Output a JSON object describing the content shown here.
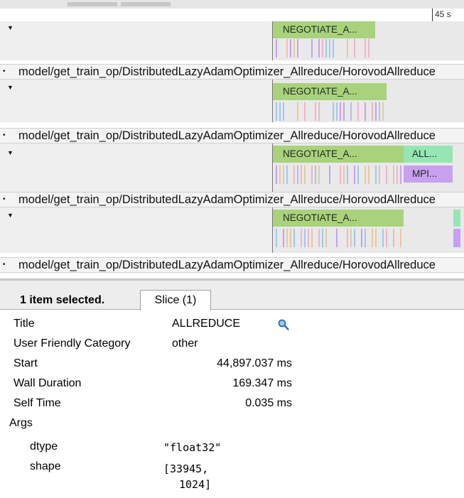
{
  "timeline": {
    "ruler_label": "45 s",
    "path_text": "model/get_train_op/DistributedLazyAdamOptimizer_Allreduce/HorovodAllreduce",
    "tracks": [
      {
        "slices": [
          {
            "label": "NEGOTIATE_A...",
            "color": "#a9d27c"
          }
        ]
      },
      {
        "slices": [
          {
            "label": "NEGOTIATE_A...",
            "color": "#a9d27c"
          }
        ]
      },
      {
        "slices": [
          {
            "label": "NEGOTIATE_A...",
            "color": "#a9d27c"
          },
          {
            "label": "ALL...",
            "color": "#96e6b4"
          },
          {
            "label": "MPI...",
            "color": "#c8a0f0"
          }
        ]
      },
      {
        "slices": [
          {
            "label": "NEGOTIATE_A...",
            "color": "#a9d27c"
          }
        ]
      }
    ]
  },
  "panel": {
    "selection_text": "1 item selected.",
    "tab_label": "Slice (1)",
    "fields": {
      "title_key": "Title",
      "title_val": "ALLREDUCE",
      "category_key": "User Friendly Category",
      "category_val": "other",
      "start_key": "Start",
      "start_val": "44,897.037 ms",
      "wall_key": "Wall Duration",
      "wall_val": "169.347 ms",
      "self_key": "Self Time",
      "self_val": "0.035 ms",
      "args_key": "Args",
      "dtype_key": "dtype",
      "dtype_val": "\"float32\"",
      "shape_key": "shape",
      "shape_val_1": "[33945,",
      "shape_val_2": "1024]"
    },
    "search_icon": "magnifier-icon"
  }
}
